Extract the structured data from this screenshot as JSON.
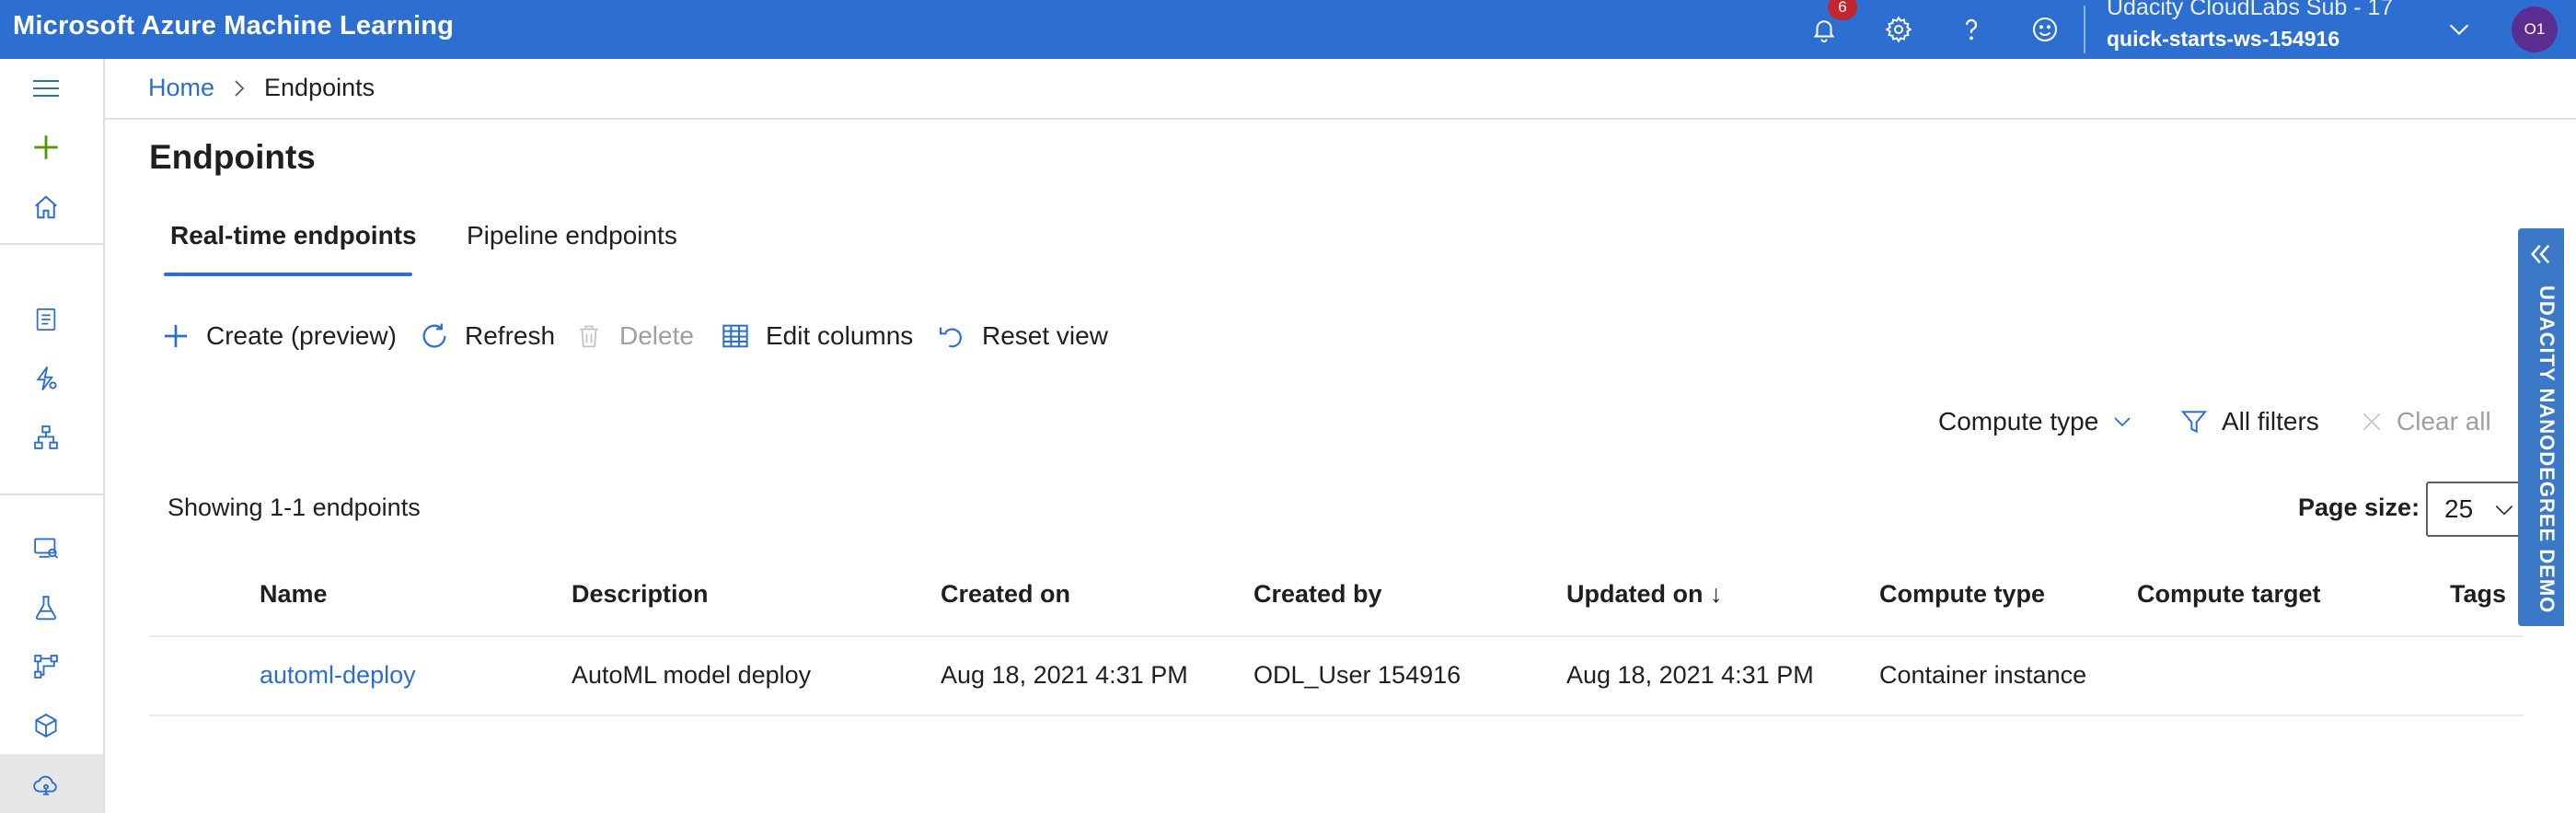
{
  "app": {
    "title": "Microsoft Azure Machine Learning"
  },
  "topbar": {
    "notification_count": "6",
    "subscription": "Udacity CloudLabs Sub - 17",
    "workspace": "quick-starts-ws-154916",
    "avatar_initials": "O1",
    "icons": [
      "bell-icon",
      "gear-icon",
      "help-icon",
      "smiley-icon",
      "chevron-down-icon"
    ]
  },
  "leftrail": {
    "icons": [
      "hamburger-icon",
      "plus-icon",
      "home-icon",
      "notebook-icon",
      "automl-icon",
      "designer-icon",
      "datasets-icon",
      "experiments-icon",
      "pipelines-icon",
      "models-icon",
      "endpoints-icon"
    ],
    "selected": "endpoints-icon"
  },
  "breadcrumb": {
    "home": "Home",
    "current": "Endpoints"
  },
  "page": {
    "title": "Endpoints"
  },
  "tabs": [
    {
      "label": "Real-time endpoints",
      "active": true
    },
    {
      "label": "Pipeline endpoints",
      "active": false
    }
  ],
  "toolbar": {
    "create": "Create (preview)",
    "refresh": "Refresh",
    "delete": "Delete",
    "edit_columns": "Edit columns",
    "reset_view": "Reset view"
  },
  "filters": {
    "compute_type": "Compute type",
    "all_filters": "All filters",
    "clear_all": "Clear all"
  },
  "list": {
    "showing": "Showing 1-1 endpoints",
    "page_size_label": "Page size:",
    "page_size_value": "25"
  },
  "table": {
    "headers": [
      "Name",
      "Description",
      "Created on",
      "Created by",
      "Updated on ↓",
      "Compute type",
      "Compute target",
      "Tags"
    ],
    "rows": [
      {
        "name": "automl-deploy",
        "description": "AutoML model deploy",
        "created_on": "Aug 18, 2021 4:31 PM",
        "created_by": "ODL_User 154916",
        "updated_on": "Aug 18, 2021 4:31 PM",
        "compute_type": "Container instance",
        "compute_target": "",
        "tags": ""
      }
    ]
  },
  "side_panel": {
    "label": "UDACITY NANODEGREE DEMO"
  },
  "colors": {
    "topbar": "#2d6fd1",
    "accent": "#2b6ed1",
    "add_green": "#4e9a06",
    "badge": "#c4262e",
    "side_panel": "#3b78c8"
  }
}
